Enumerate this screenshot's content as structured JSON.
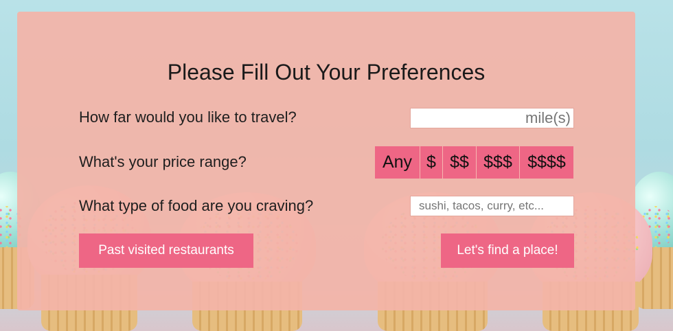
{
  "form": {
    "title": "Please Fill Out Your Preferences",
    "distance": {
      "question": "How far would you like to travel?",
      "placeholder": "mile(s)"
    },
    "price": {
      "question": "What's your price range?",
      "options": [
        "Any",
        "$",
        "$$",
        "$$$",
        "$$$$"
      ]
    },
    "food": {
      "question": "What type of food are you craving?",
      "placeholder": "sushi, tacos, curry, etc..."
    },
    "buttons": {
      "past": "Past visited restaurants",
      "find": "Let's find a place!"
    }
  },
  "colors": {
    "accent": "#ee6685",
    "panel": "#f3b4a8",
    "text": "#1e1e1e"
  }
}
